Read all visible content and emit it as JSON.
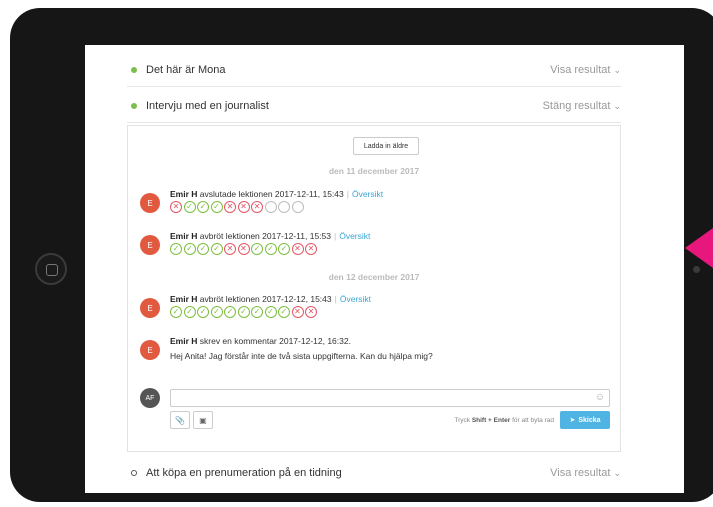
{
  "lessons": [
    {
      "title": "Det här är Mona",
      "toggle": "Visa resultat",
      "status": "done"
    },
    {
      "title": "Intervju med en journalist",
      "toggle": "Stäng resultat",
      "status": "done"
    },
    {
      "title": "Att köpa en prenumeration på en tidning",
      "toggle": "Visa resultat",
      "status": "empty"
    }
  ],
  "panel": {
    "load_older": "Ladda in äldre",
    "dates": [
      "den 11 december 2017",
      "den 12 december 2017"
    ],
    "entries": [
      {
        "initial": "E",
        "name": "Emir H",
        "action": " avslutade lektionen 2017-12-11, 15:43",
        "link": "Översikt",
        "marks": [
          "err",
          "ok",
          "ok",
          "ok",
          "err",
          "err",
          "err",
          "none",
          "none",
          "none"
        ]
      },
      {
        "initial": "E",
        "name": "Emir H",
        "action": " avbröt lektionen 2017-12-11, 15:53",
        "link": "Översikt",
        "marks": [
          "ok",
          "ok",
          "ok",
          "ok",
          "err",
          "err",
          "ok",
          "ok",
          "ok",
          "err",
          "err"
        ]
      },
      {
        "initial": "E",
        "name": "Emir H",
        "action": " avbröt lektionen 2017-12-12, 15:43",
        "link": "Översikt",
        "marks": [
          "ok",
          "ok",
          "ok",
          "ok",
          "ok",
          "ok",
          "ok",
          "ok",
          "ok",
          "err",
          "err"
        ]
      },
      {
        "initial": "E",
        "name": "Emir H",
        "action": " skrev en kommentar 2017-12-12, 16:32.",
        "comment": "Hej Anita! Jag förstår inte de två sista uppgifterna. Kan du hjälpa mig?"
      }
    ],
    "composer": {
      "avatar": "AF",
      "hint_prefix": "Tryck ",
      "hint_keys": "Shift + Enter",
      "hint_suffix": " för att byta rad",
      "send_label": "Skicka"
    }
  },
  "icons": {
    "check": "check-icon",
    "cross": "cross-icon",
    "paperclip": "paperclip-icon",
    "image": "image-icon",
    "emoji": "emoji-icon",
    "send": "send-icon"
  },
  "colors": {
    "ok": "#7cbf3e",
    "err": "#e45766",
    "link": "#3ba6d6",
    "send": "#4fb3e3",
    "avatar": "#e15a40"
  }
}
